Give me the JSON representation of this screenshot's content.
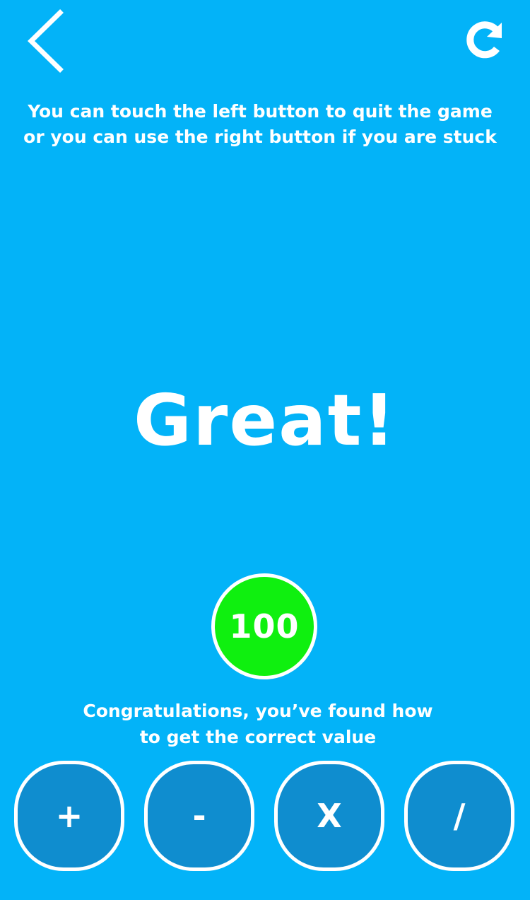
{
  "nav": {
    "back_icon": "chevron-left-icon",
    "restart_icon": "restart-icon"
  },
  "instructions": {
    "line1": "You can touch the left button to quit the game",
    "line2": "or you can use the right button if you are stuck"
  },
  "result": {
    "headline": "Great!",
    "score": "100",
    "message_line1": "Congratulations, you’ve found how",
    "message_line2": "to get the correct value"
  },
  "operators": [
    {
      "label": "+"
    },
    {
      "label": "-"
    },
    {
      "label": "X"
    },
    {
      "label": "/"
    }
  ],
  "colors": {
    "background": "#03b3f8",
    "button": "#0f8dcf",
    "score": "#0ff00f",
    "foreground": "#ffffff"
  }
}
